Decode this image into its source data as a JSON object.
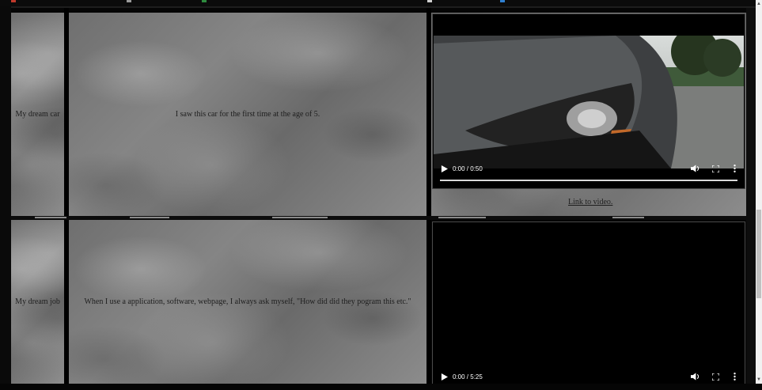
{
  "rows": [
    {
      "label": "My dream car",
      "description": "I saw this car for the first time at the age of 5.",
      "video": {
        "time": "0:00 / 0:50",
        "progress": 0
      },
      "link_text": "Link to video."
    },
    {
      "label": "My dream job",
      "description": "When I use a application, software, webpage, I always ask myself, \"How did did they pogram this etc.\"",
      "video": {
        "time": "0:00 / 5:25",
        "progress": 0
      }
    }
  ],
  "icons": {
    "play": "play-icon",
    "volume": "volume-icon",
    "fullscreen": "fullscreen-icon",
    "more": "more-vert-icon"
  },
  "colors": {
    "cell_text": "#1e1e1e",
    "marble_base": "#7a7a7a",
    "video_bg": "#000000"
  }
}
